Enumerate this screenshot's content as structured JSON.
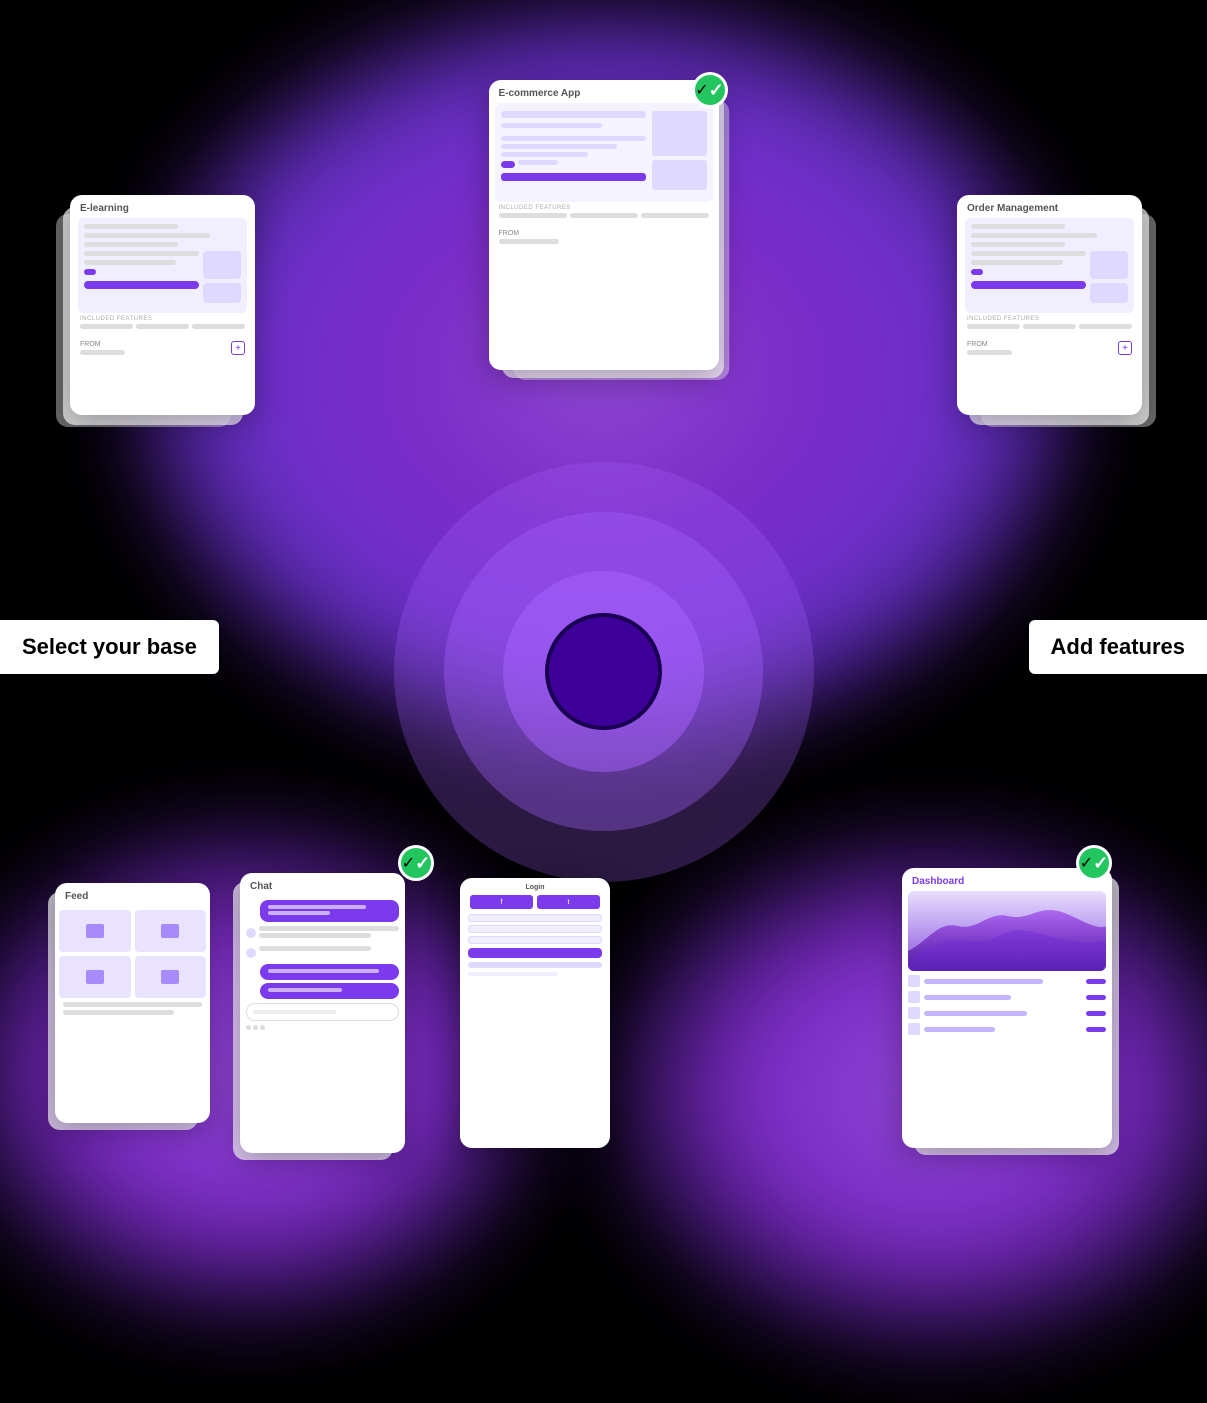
{
  "scene": {
    "background": "#000000"
  },
  "cards": {
    "ecommerce": {
      "title": "E-commerce App",
      "badge": "✓",
      "features_label": "INCLUDED FEATURES",
      "from_label": "FROM",
      "price": "$"
    },
    "elearning": {
      "title": "E-learning",
      "features_label": "INCLUDED FEATURES",
      "from_label": "FROM",
      "price": "$"
    },
    "order_management": {
      "title": "Order Management",
      "features_label": "INCLUDED FEATURES",
      "from_label": "FROM",
      "price": "$"
    },
    "feed": {
      "title": "Feed"
    },
    "chat": {
      "title": "Chat",
      "badge": "✓"
    },
    "login": {
      "title": "Login"
    },
    "dashboard": {
      "title": "Dashboard",
      "badge": "✓"
    }
  },
  "labels": {
    "select_base": "Select your base",
    "add_features": "Add features"
  }
}
